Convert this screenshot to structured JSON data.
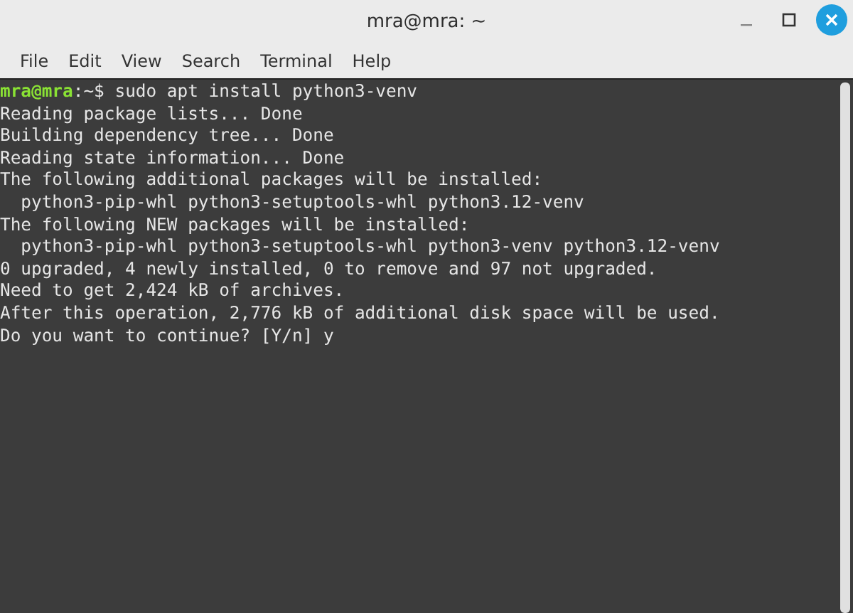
{
  "window": {
    "title": "mra@mra: ~"
  },
  "menu": [
    "File",
    "Edit",
    "View",
    "Search",
    "Terminal",
    "Help"
  ],
  "terminal": {
    "prompt": {
      "user_host": "mra@mra",
      "path": ":~$",
      "command": "sudo apt install python3-venv"
    },
    "lines": [
      "Reading package lists... Done",
      "Building dependency tree... Done",
      "Reading state information... Done",
      "The following additional packages will be installed:",
      "  python3-pip-whl python3-setuptools-whl python3.12-venv",
      "The following NEW packages will be installed:",
      "  python3-pip-whl python3-setuptools-whl python3-venv python3.12-venv",
      "0 upgraded, 4 newly installed, 0 to remove and 97 not upgraded.",
      "Need to get 2,424 kB of archives.",
      "After this operation, 2,776 kB of additional disk space will be used.",
      "Do you want to continue? [Y/n] y"
    ]
  }
}
